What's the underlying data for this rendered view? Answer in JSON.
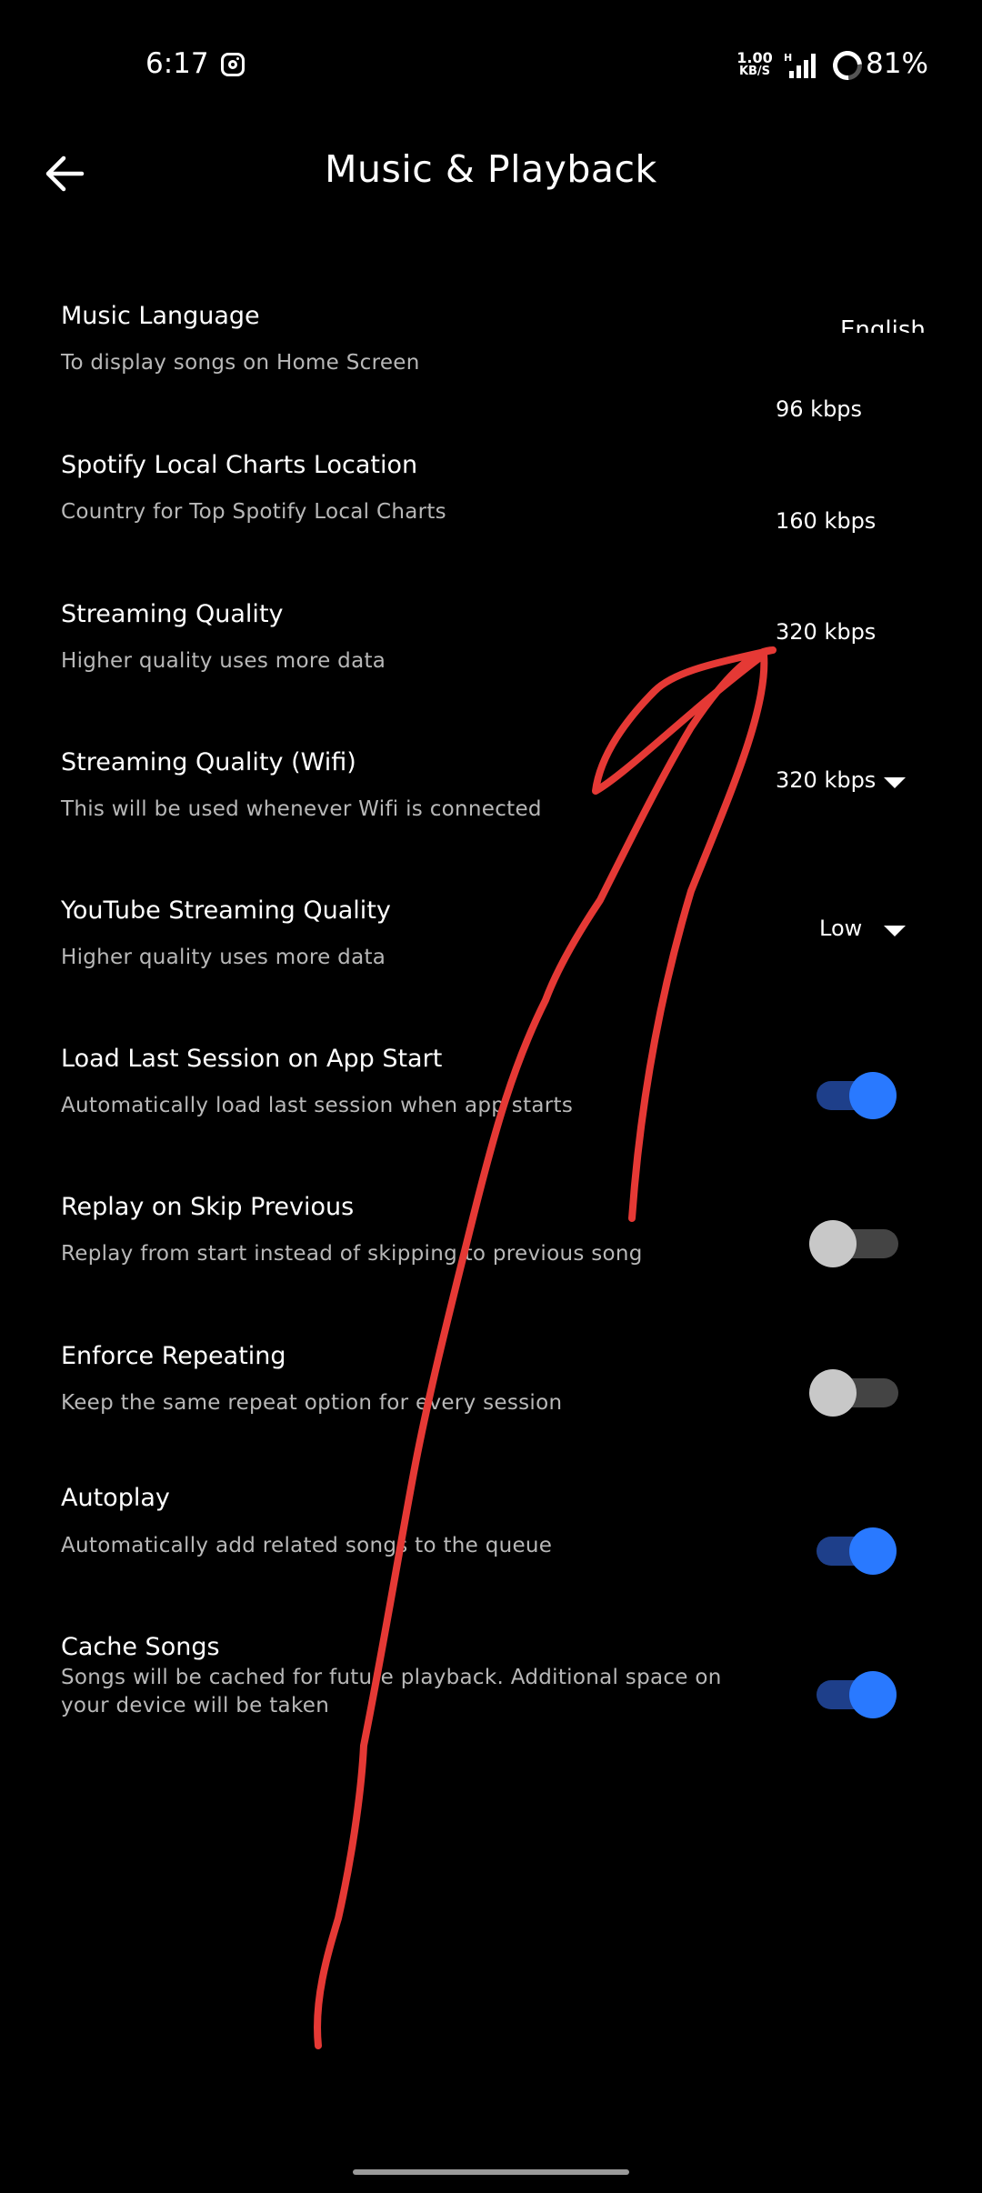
{
  "status_bar": {
    "time": "6:17",
    "net_speed_value": "1.00",
    "net_speed_unit": "KB/S",
    "battery": "81%",
    "icons": [
      "instagram-icon",
      "signal-icon",
      "battery-icon"
    ]
  },
  "header": {
    "title": "Music & Playback",
    "back_icon": "arrow-left-icon"
  },
  "settings": [
    {
      "title": "Music Language",
      "subtitle": "To display songs on Home Screen",
      "value": "English"
    },
    {
      "title": "Spotify Local Charts Location",
      "subtitle": "Country for Top Spotify Local Charts"
    },
    {
      "title": "Streaming Quality",
      "subtitle": "Higher quality uses more data",
      "options": [
        "96 kbps",
        "160 kbps",
        "320 kbps"
      ]
    },
    {
      "title": "Streaming Quality (Wifi)",
      "subtitle": "This will be used whenever Wifi is connected",
      "value": "320 kbps"
    },
    {
      "title": "YouTube Streaming Quality",
      "subtitle": "Higher quality uses more data",
      "value": "Low"
    },
    {
      "title": "Load Last Session on App Start",
      "subtitle": "Automatically load last session when app starts",
      "enabled": true
    },
    {
      "title": "Replay on Skip Previous",
      "subtitle": "Replay from start instead of skipping to previous song",
      "enabled": false
    },
    {
      "title": "Enforce Repeating",
      "subtitle": "Keep the same repeat option for every session",
      "enabled": false
    },
    {
      "title": "Autoplay",
      "subtitle": "Automatically add related songs to the queue",
      "enabled": true
    },
    {
      "title": "Cache Songs",
      "subtitle": "Songs will be cached for future playback. Additional space on your device will be taken",
      "enabled": true
    }
  ],
  "colors": {
    "background": "#000000",
    "toggle_on_thumb": "#2979ff",
    "toggle_on_track": "#1e3f8a",
    "toggle_off_thumb": "#c8c8c8",
    "toggle_off_track": "#444444",
    "annotation": "#e53935"
  }
}
